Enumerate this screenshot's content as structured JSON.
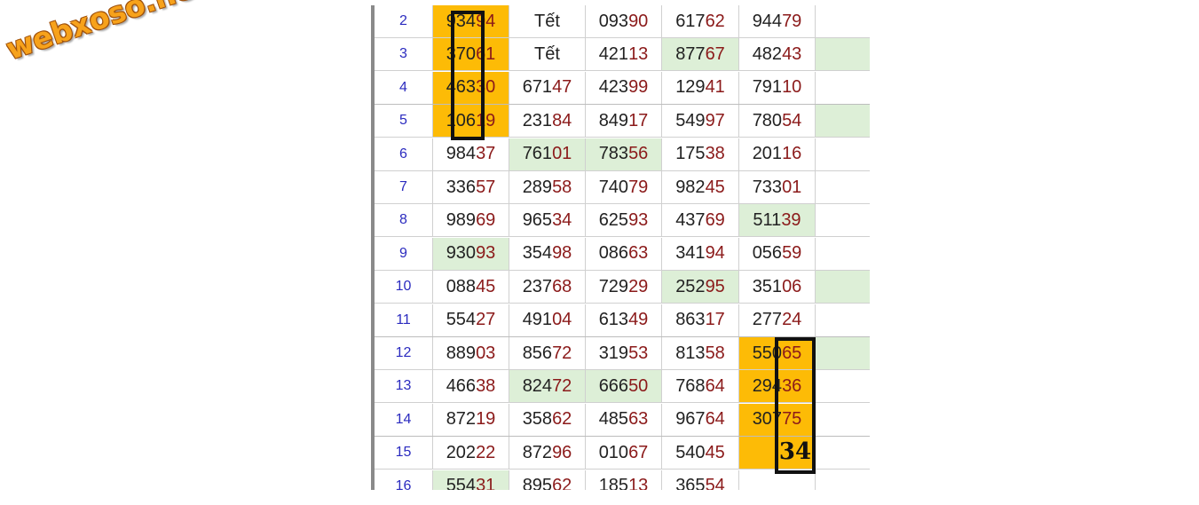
{
  "logo": {
    "text": "webxoso.net"
  },
  "colors": {
    "row_number": "#2b2bbf",
    "digit_head": "#222222",
    "digit_tail": "#8b1a1a",
    "highlight_green": "#ddefd7",
    "highlight_orange": "#fdbb06"
  },
  "rows": [
    {
      "n": "2",
      "cells": [
        {
          "v": "93494",
          "hl": "o"
        },
        {
          "v": "Tết"
        },
        {
          "v": "09390"
        },
        {
          "v": "61762"
        },
        {
          "v": "94479"
        }
      ],
      "extra": ""
    },
    {
      "n": "3",
      "cells": [
        {
          "v": "37061",
          "hl": "o"
        },
        {
          "v": "Tết"
        },
        {
          "v": "42113"
        },
        {
          "v": "87767",
          "hl": "g"
        },
        {
          "v": "48243"
        }
      ],
      "extra": "g"
    },
    {
      "n": "4",
      "cells": [
        {
          "v": "46330",
          "hl": "o"
        },
        {
          "v": "67147"
        },
        {
          "v": "42399"
        },
        {
          "v": "12941"
        },
        {
          "v": "79110"
        }
      ],
      "extra": ""
    },
    {
      "n": "5",
      "cells": [
        {
          "v": "10619",
          "hl": "o"
        },
        {
          "v": "23184"
        },
        {
          "v": "84917"
        },
        {
          "v": "54997"
        },
        {
          "v": "78054"
        }
      ],
      "extra": "g"
    },
    {
      "n": "6",
      "cells": [
        {
          "v": "98437"
        },
        {
          "v": "76101",
          "hl": "g"
        },
        {
          "v": "78356",
          "hl": "g"
        },
        {
          "v": "17538"
        },
        {
          "v": "20116"
        }
      ],
      "extra": ""
    },
    {
      "n": "7",
      "cells": [
        {
          "v": "33657"
        },
        {
          "v": "28958"
        },
        {
          "v": "74079"
        },
        {
          "v": "98245"
        },
        {
          "v": "73301"
        }
      ],
      "extra": ""
    },
    {
      "n": "8",
      "cells": [
        {
          "v": "98969"
        },
        {
          "v": "96534"
        },
        {
          "v": "62593"
        },
        {
          "v": "43769"
        },
        {
          "v": "51139",
          "hl": "g"
        }
      ],
      "extra": ""
    },
    {
      "n": "9",
      "cells": [
        {
          "v": "93093",
          "hl": "g"
        },
        {
          "v": "35498"
        },
        {
          "v": "08663"
        },
        {
          "v": "34194"
        },
        {
          "v": "05659"
        }
      ],
      "extra": ""
    },
    {
      "n": "10",
      "cells": [
        {
          "v": "08845"
        },
        {
          "v": "23768"
        },
        {
          "v": "72929"
        },
        {
          "v": "25295",
          "hl": "g"
        },
        {
          "v": "35106"
        }
      ],
      "extra": "g"
    },
    {
      "n": "11",
      "cells": [
        {
          "v": "55427"
        },
        {
          "v": "49104"
        },
        {
          "v": "61349"
        },
        {
          "v": "86317"
        },
        {
          "v": "27724"
        }
      ],
      "extra": ""
    },
    {
      "n": "12",
      "cells": [
        {
          "v": "88903"
        },
        {
          "v": "85672"
        },
        {
          "v": "31953"
        },
        {
          "v": "81358"
        },
        {
          "v": "55065",
          "hl": "o"
        }
      ],
      "extra": "g"
    },
    {
      "n": "13",
      "cells": [
        {
          "v": "46638"
        },
        {
          "v": "82472",
          "hl": "g"
        },
        {
          "v": "66650",
          "hl": "g"
        },
        {
          "v": "76864"
        },
        {
          "v": "29436",
          "hl": "o"
        }
      ],
      "extra": ""
    },
    {
      "n": "14",
      "cells": [
        {
          "v": "87219"
        },
        {
          "v": "35862"
        },
        {
          "v": "48563"
        },
        {
          "v": "96764"
        },
        {
          "v": "30775",
          "hl": "o"
        }
      ],
      "extra": ""
    },
    {
      "n": "15",
      "cells": [
        {
          "v": "20222"
        },
        {
          "v": "87296"
        },
        {
          "v": "01067"
        },
        {
          "v": "54045"
        },
        {
          "v": "",
          "hl": "o"
        }
      ],
      "extra": ""
    },
    {
      "n": "16",
      "cells": [
        {
          "v": "55431",
          "hl": "g"
        },
        {
          "v": "89562"
        },
        {
          "v": "18513"
        },
        {
          "v": "36554"
        },
        {
          "v": ""
        }
      ],
      "extra": ""
    }
  ],
  "annotation": {
    "prediction": "34"
  }
}
